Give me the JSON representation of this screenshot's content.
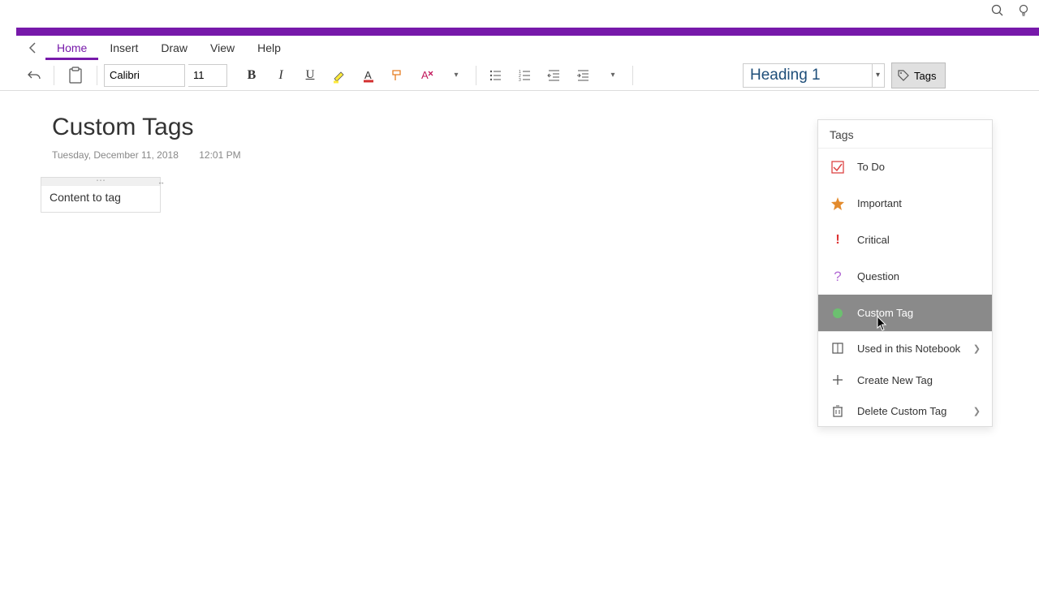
{
  "tabs": {
    "home": "Home",
    "insert": "Insert",
    "draw": "Draw",
    "view": "View",
    "help": "Help"
  },
  "font": {
    "name": "Calibri",
    "size": "11"
  },
  "style_selector": "Heading 1",
  "tags_button": "Tags",
  "page": {
    "title": "Custom Tags",
    "date": "Tuesday, December 11, 2018",
    "time": "12:01 PM",
    "note_text": "Content to tag"
  },
  "tags_panel": {
    "header": "Tags",
    "items": [
      {
        "label": "To Do"
      },
      {
        "label": "Important"
      },
      {
        "label": "Critical"
      },
      {
        "label": "Question"
      },
      {
        "label": "Custom Tag"
      }
    ],
    "used": "Used in this Notebook",
    "create": "Create New Tag",
    "delete": "Delete Custom Tag"
  }
}
